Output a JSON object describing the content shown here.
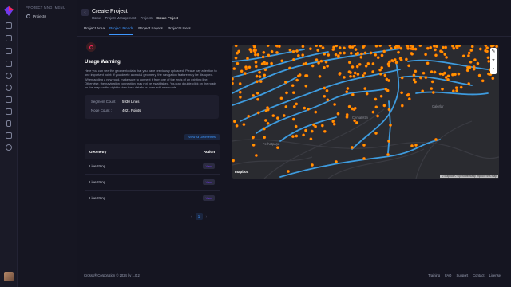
{
  "sidebar": {
    "heading": "PROJECT MNG. MENU",
    "items": [
      {
        "label": "Projects",
        "icon": "globe-icon"
      }
    ],
    "rail_icons": [
      "logo-icon",
      "dashboard-icon",
      "image-icon",
      "layers-icon",
      "flag-icon",
      "users-icon",
      "database-icon",
      "stack-icon",
      "grid-icon",
      "mobile-icon",
      "list-icon",
      "settings-icon"
    ]
  },
  "header": {
    "title": "Create Project",
    "breadcrumbs": [
      "Home",
      "Project Management",
      "Projects",
      "Create Project"
    ]
  },
  "tabs": [
    {
      "label": "Project Area",
      "active": false
    },
    {
      "label": "Project Roads",
      "active": true
    },
    {
      "label": "Project Layers",
      "active": false
    },
    {
      "label": "Project Users",
      "active": false
    }
  ],
  "warning": {
    "title": "Usage Warning",
    "body": "Here you can see the geometric data that you have previously uploaded. Please pay attention to one important point: If you delete a crucial geometry, the navigation feature may be disrupted. When adding a new road, make sure to connect it from one of the ends of an existing line. Otherwise, the navigation connection may not be established. You can double-click on the roads on the map on the right to view their details or even add new roads."
  },
  "stats": {
    "segment_label": "Segment Count :",
    "segment_value": "5930 Lines",
    "node_label": "Node Count :",
    "node_value": "4021 Points"
  },
  "view_all_label": "View All Geometries",
  "table": {
    "headers": [
      "Geometry",
      "Action"
    ],
    "rows": [
      {
        "geometry": "LineString",
        "action": "View"
      },
      {
        "geometry": "LineString",
        "action": "View"
      },
      {
        "geometry": "LineString",
        "action": "View"
      }
    ]
  },
  "pagination": {
    "prev": "‹",
    "current": "1",
    "next": "›"
  },
  "map": {
    "controls": [
      "pen-icon",
      "marker-icon",
      "trash-icon"
    ],
    "logo_text": "mapbox",
    "attribution": "© Mapbox © OpenStreetMap Improve this map",
    "district_labels": [
      "Ferhatpaşa",
      "Cemalettin",
      "Çakırlar"
    ]
  },
  "footer": {
    "copyright": "Crosss® Corporation © 2024 | v 1.0.2",
    "links": [
      "Training",
      "FAQ",
      "Support",
      "Contact",
      "License"
    ]
  },
  "colors": {
    "accent": "#3e97ff",
    "danger": "#f8285a",
    "road": "#3e9bde",
    "node": "#ff9800"
  }
}
